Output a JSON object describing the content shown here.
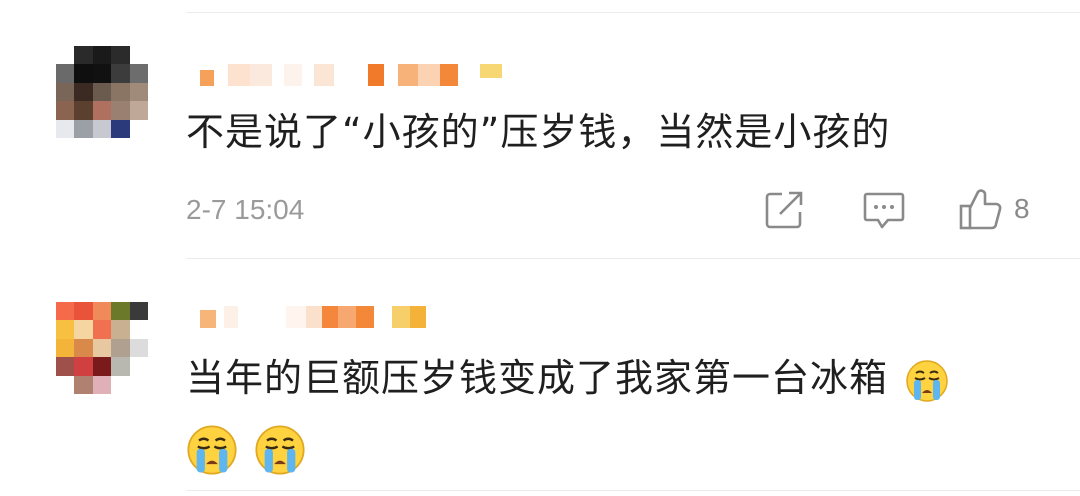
{
  "comments": [
    {
      "username": "",
      "text": "不是说了“小孩的”压岁钱，当然是小孩的",
      "time": "2-7 15:04",
      "actions": {
        "share_icon": "share-icon",
        "reply_icon": "comment-icon",
        "like_icon": "thumbs-up-icon",
        "like_count": "8"
      }
    },
    {
      "username": "",
      "text": "当年的巨额压岁钱变成了我家第一台冰箱",
      "emoji_name": "crying-emoji"
    }
  ],
  "colors": {
    "text_primary": "#1f1f1f",
    "text_meta": "#9a9a9a",
    "icon_gray": "#8a8a8a",
    "divider": "#ececec",
    "emoji_face": "#ffd23f",
    "emoji_tear": "#5db6f0"
  }
}
